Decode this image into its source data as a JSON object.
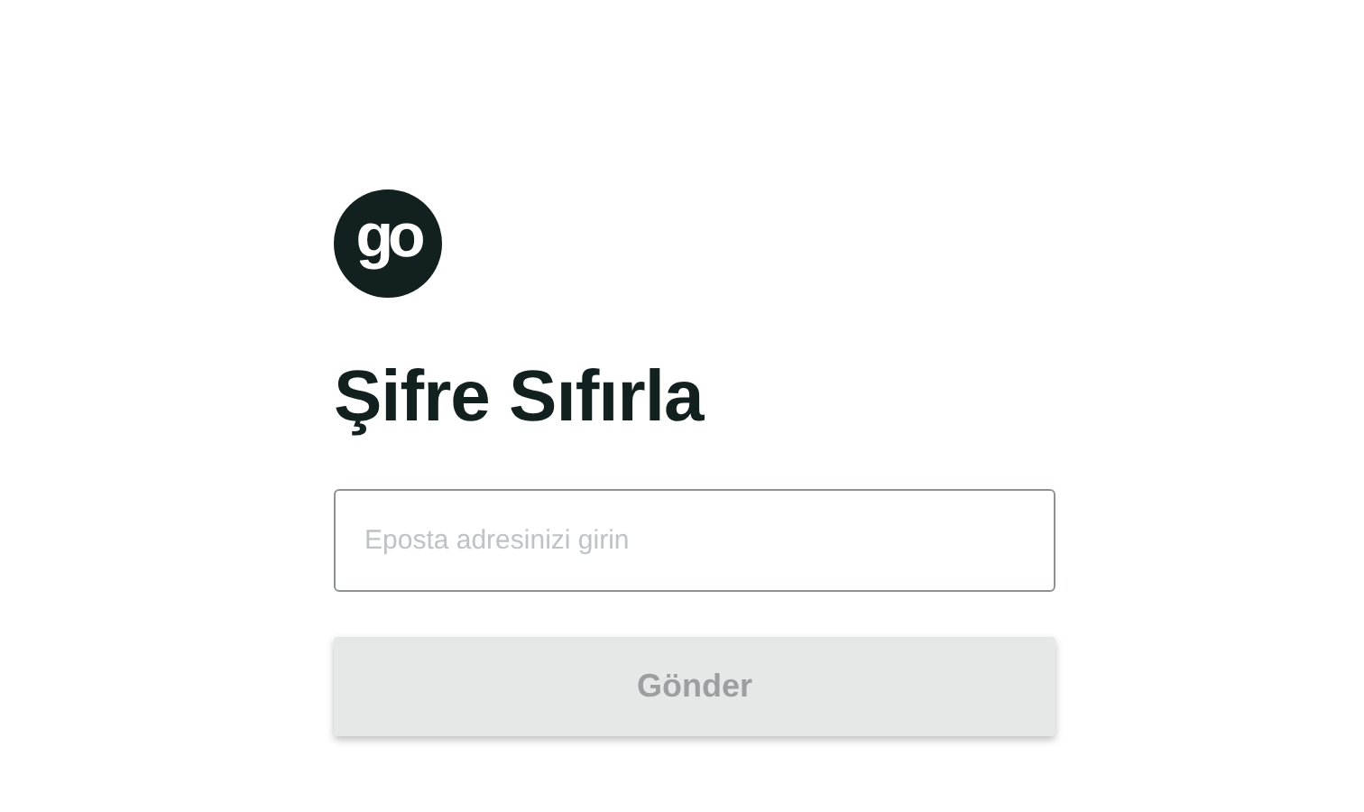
{
  "logo": {
    "text": "go"
  },
  "title": "Şifre Sıfırla",
  "email_field": {
    "placeholder": "Eposta adresinizi girin"
  },
  "submit_button": {
    "label": "Gönder",
    "disabled": true
  }
}
